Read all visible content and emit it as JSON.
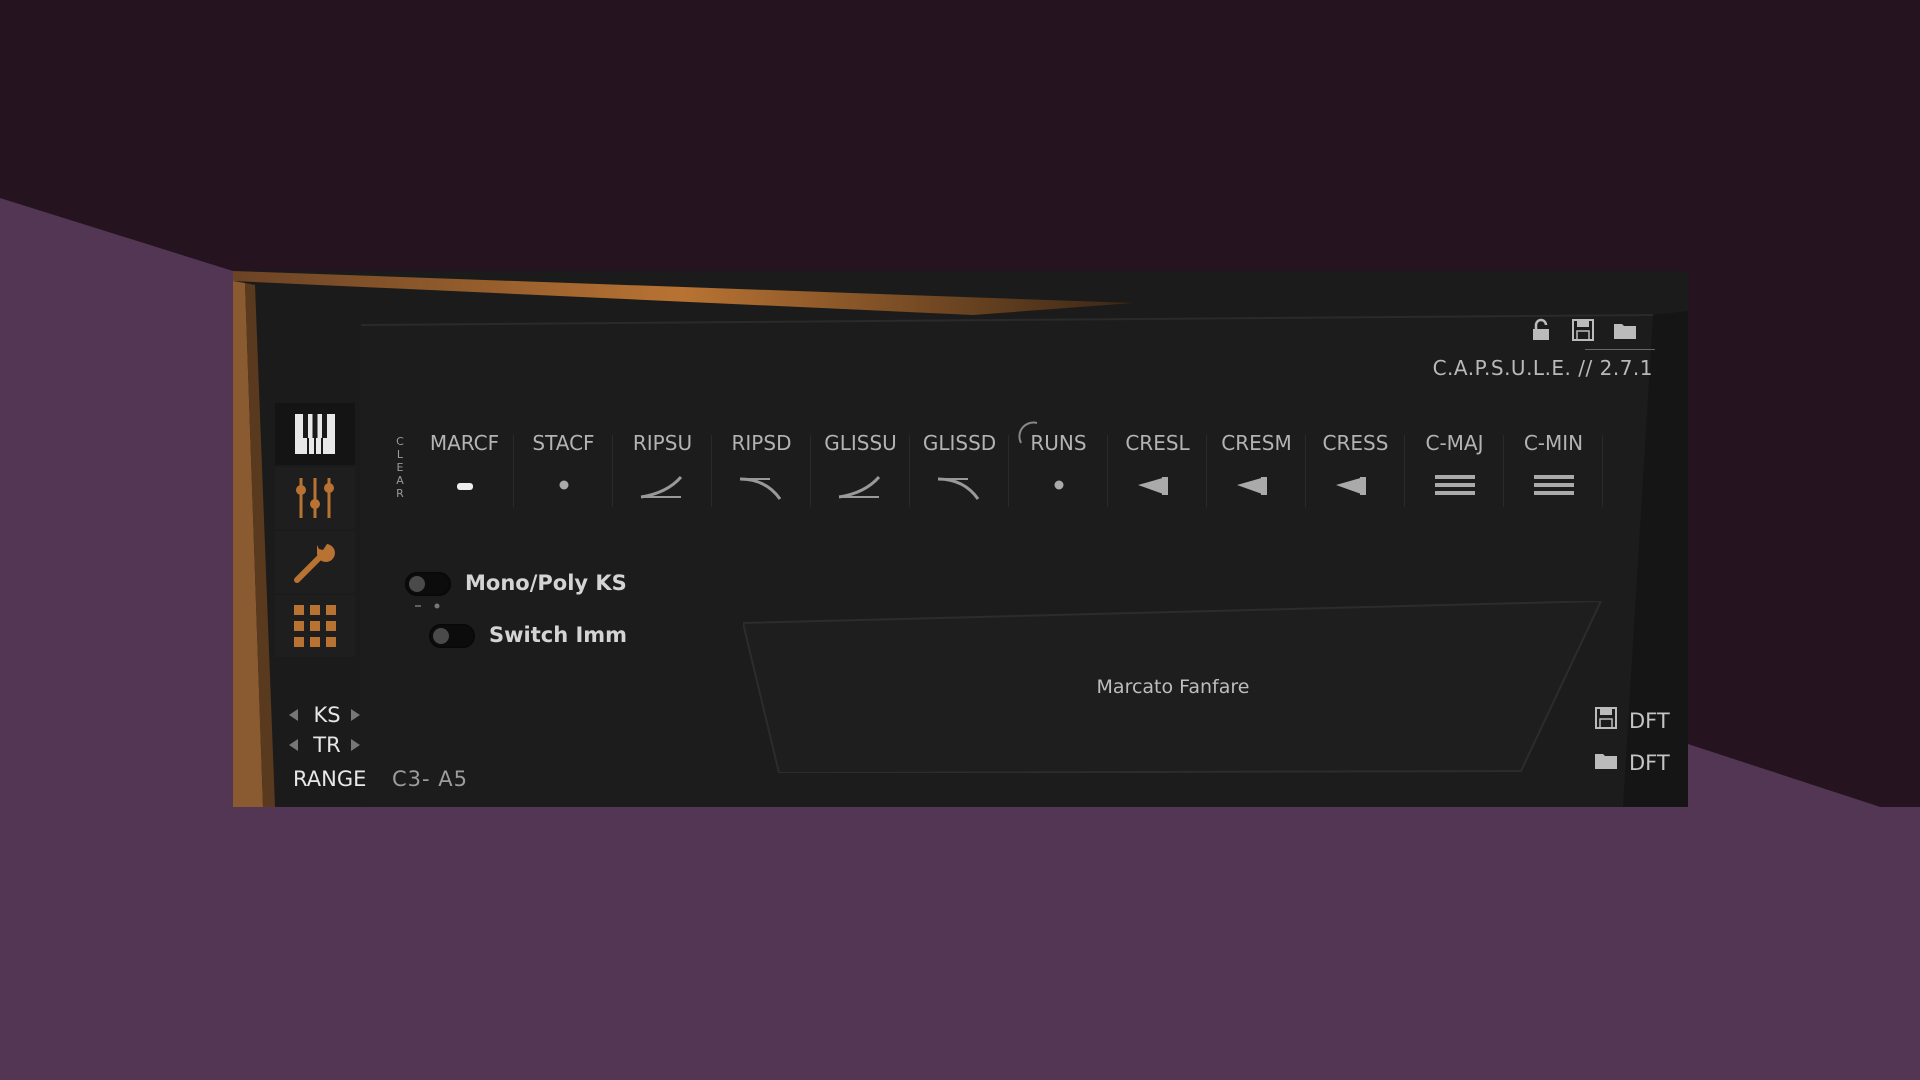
{
  "app": {
    "version": "C.A.P.S.U.L.E. // 2.7.1"
  },
  "header_icons": [
    "lock-icon",
    "save-icon",
    "folder-icon"
  ],
  "nav": {
    "items": [
      "piano-keys-icon",
      "mixer-sliders-icon",
      "wrench-icon",
      "grid-icon"
    ],
    "active_index": 0
  },
  "clear_label": [
    "C",
    "L",
    "E",
    "A",
    "R"
  ],
  "articulations": [
    {
      "label": "MARCF",
      "icon": "marcato-dash"
    },
    {
      "label": "STACF",
      "icon": "staccato-dot"
    },
    {
      "label": "RIPSU",
      "icon": "rip-up"
    },
    {
      "label": "RIPSD",
      "icon": "rip-down"
    },
    {
      "label": "GLISSU",
      "icon": "gliss-up"
    },
    {
      "label": "GLISSD",
      "icon": "gliss-down"
    },
    {
      "label": "RUNS",
      "icon": "runs-dot"
    },
    {
      "label": "CRESL",
      "icon": "crescendo"
    },
    {
      "label": "CRESM",
      "icon": "crescendo"
    },
    {
      "label": "CRESS",
      "icon": "crescendo"
    },
    {
      "label": "C-MAJ",
      "icon": "chord-lines"
    },
    {
      "label": "C-MIN",
      "icon": "chord-lines"
    }
  ],
  "toggles": {
    "mono_poly": {
      "label": "Mono/Poly KS",
      "on": false
    },
    "switch_imm": {
      "label": "Switch Imm",
      "on": false
    }
  },
  "status": {
    "current_patch": "Marcato Fanfare"
  },
  "keyswitch": {
    "ks_label": "KS",
    "tr_label": "TR",
    "range_label": "RANGE",
    "range_value": "C3- A5"
  },
  "defaults": {
    "save_label": "DFT",
    "load_label": "DFT"
  },
  "colors": {
    "accent": "#b87333",
    "background": "#25131f",
    "background_band": "#523653",
    "panel": "#1a1a1a",
    "text": "#b3b3b3"
  }
}
